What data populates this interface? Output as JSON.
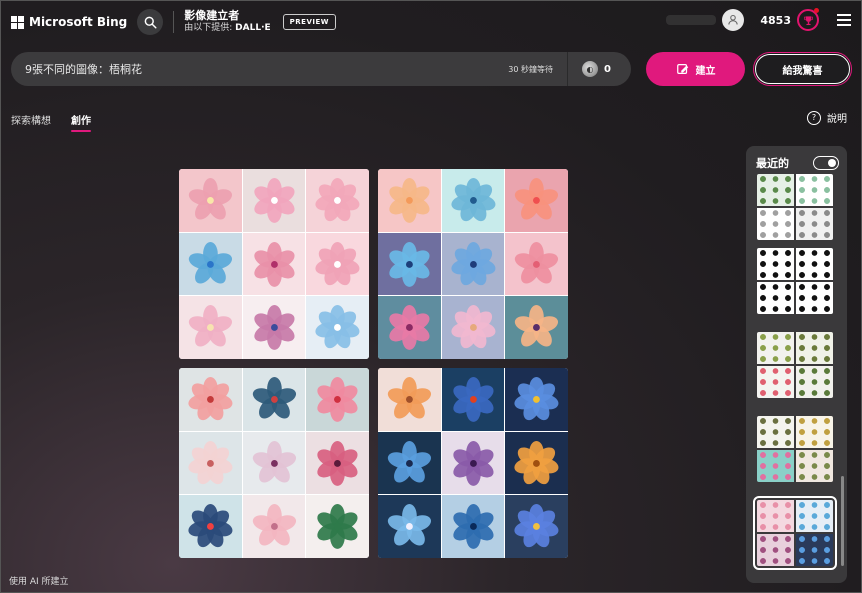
{
  "header": {
    "brand": "Microsoft Bing",
    "title": "影像建立者",
    "subtitle_prefix": "由以下提供:",
    "subtitle_provider": "DALL·E",
    "preview_badge": "PREVIEW",
    "points": "4853"
  },
  "prompt": {
    "text": "9張不同的圖像：梧桐花",
    "wait_text": "30 秒鐘等待",
    "boost_count": "0"
  },
  "buttons": {
    "create": "建立",
    "surprise": "給我驚喜"
  },
  "tabs": [
    {
      "label": "探索構想",
      "active": false
    },
    {
      "label": "創作",
      "active": true
    }
  ],
  "help_label": "說明",
  "recent": {
    "title": "最近的"
  },
  "footer": "使用 AI 所建立",
  "colors": {
    "accent": "#e0197d",
    "background": "#1c1a1c",
    "panel": "#3a393b"
  },
  "images": [
    {
      "palette": [
        "#f3c6cb",
        "#eadede",
        "#f5d3d8",
        "#c9dbe6",
        "#f7e1e5",
        "#f9d8de",
        "#f5e3e6",
        "#f7eef0",
        "#e6eef5"
      ],
      "petals": [
        "#eda0b0",
        "#f1a5bd",
        "#f2a7ba",
        "#5aa9d9",
        "#e890a8",
        "#f0a3b6",
        "#f0b0c4",
        "#c77aa8",
        "#88bfe6"
      ],
      "cores": [
        "#f9e7a9",
        "#ffffff",
        "#ffffff",
        "#2a75c9",
        "#b0306a",
        "#ffffff",
        "#f7e3b0",
        "#3b4c9c",
        "#ffffff"
      ]
    },
    {
      "palette": [
        "#f6c6c6",
        "#c8ebeb",
        "#eaa4ae",
        "#6f6f9f",
        "#a8b3cf",
        "#f4c3cc",
        "#5f8d9f",
        "#a8b3d0",
        "#5c8e99"
      ],
      "petals": [
        "#f5b788",
        "#6eb6d8",
        "#f7917d",
        "#69b8e6",
        "#6ea8df",
        "#ee8fa0",
        "#e87aa6",
        "#f1b7cf",
        "#f5b487"
      ],
      "cores": [
        "#f49a5a",
        "#215b8e",
        "#f04f4f",
        "#1d3f7a",
        "#1f3d7a",
        "#e45f74",
        "#8a2a63",
        "#e6a97c",
        "#5a2e6a"
      ]
    },
    {
      "palette": [
        "#dfe4e5",
        "#dbe5e8",
        "#c9d7d8",
        "#dde5e8",
        "#e7eaed",
        "#ecdfe2",
        "#cfe3e8",
        "#f2e8ea",
        "#f4efee"
      ],
      "petals": [
        "#f2a0a0",
        "#2e5a7a",
        "#f08aa0",
        "#f3d3d3",
        "#e3c2d5",
        "#d86080",
        "#2a4a7a",
        "#f3b5c0",
        "#2e7a4a"
      ],
      "cores": [
        "#c43a3a",
        "#d04040",
        "#d03040",
        "#c86060",
        "#7a3060",
        "#5a1a3a",
        "#f04040",
        "#c2708a",
        "#2e7a4a"
      ]
    },
    {
      "palette": [
        "#f1ded8",
        "#1b3f63",
        "#1b2e52",
        "#1a3450",
        "#e7ddea",
        "#1b2e4f",
        "#1d3858",
        "#b4cfe4",
        "#2a3f5f"
      ],
      "petals": [
        "#f29b58",
        "#3a68c0",
        "#5a8ee0",
        "#5a9ede",
        "#8a5aa8",
        "#f0a040",
        "#7ab8e8",
        "#2e6cb0",
        "#5a80e0"
      ],
      "cores": [
        "#a0502a",
        "#e04020",
        "#f0c030",
        "#1a2a50",
        "#3a1a50",
        "#a05010",
        "#f0f0ff",
        "#0a2a5a",
        "#f0c040"
      ]
    }
  ],
  "recent_thumbs": [
    {
      "colors": [
        "#e6f0e6",
        "#ffffff",
        "#ffffff",
        "#f0f0f0"
      ],
      "dots": [
        "#5a8a4a",
        "#8ac0a0",
        "#a0a0a0",
        "#8a8a8a"
      ]
    },
    {
      "colors": [
        "#ffffff",
        "#ffffff",
        "#ffffff",
        "#ffffff"
      ],
      "dots": [
        "#111111",
        "#111111",
        "#111111",
        "#111111"
      ]
    },
    {
      "colors": [
        "#f2f2ee",
        "#f0f2e8",
        "#f4f4f0",
        "#f1f1ec"
      ],
      "dots": [
        "#8aa04a",
        "#6a7a3a",
        "#e06070",
        "#5a7a3a"
      ]
    },
    {
      "colors": [
        "#f4f4ee",
        "#f8f4e8",
        "#8ad0c8",
        "#f0e8e0"
      ],
      "dots": [
        "#6a7040",
        "#c0a040",
        "#e070a0",
        "#7a8a4a"
      ]
    },
    {
      "colors": [
        "#f4d8e0",
        "#e6eef6",
        "#e8d0dc",
        "#2a3a5a"
      ],
      "dots": [
        "#e890a8",
        "#5aa9d9",
        "#a05080",
        "#5a9ee0"
      ]
    }
  ]
}
